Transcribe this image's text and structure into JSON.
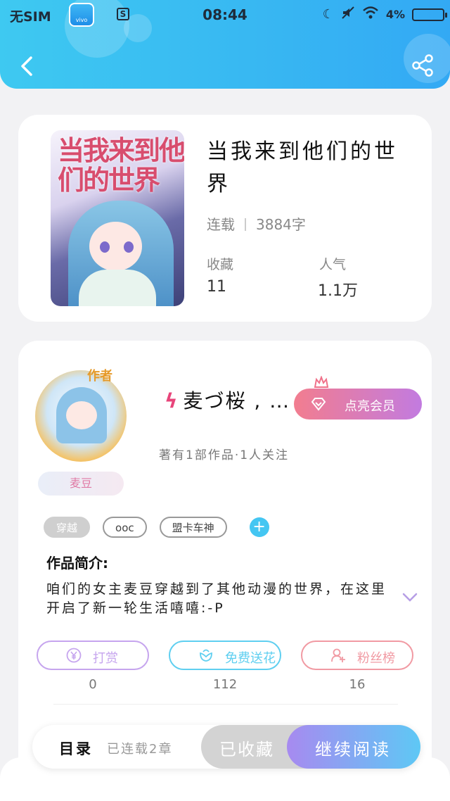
{
  "status_bar": {
    "carrier": "无SIM",
    "vivo_label": "vivo",
    "s_label": "S",
    "time": "08:44",
    "battery": "4%"
  },
  "book": {
    "cover_title": "当我来到他们的世界",
    "title": "当我来到他们的世界",
    "status": "连载",
    "word_count": "3884字",
    "stats": [
      {
        "label": "收藏",
        "value": "11"
      },
      {
        "label": "人气",
        "value": "1.1万"
      }
    ]
  },
  "author": {
    "role_badge": "作者",
    "name": "麦づ桜 , …",
    "meta": "著有1部作品·1人关注",
    "nickname_pill": "麦豆",
    "vip_button": "点亮会员"
  },
  "tags": [
    "穿越",
    "ooc",
    "盟卡车神"
  ],
  "intro": {
    "heading": "作品简介:",
    "text": "咱们的女主麦豆穿越到了其他动漫的世界，在这里开启了新一轮生活嘻嘻:-P"
  },
  "actions": [
    {
      "label": "打赏",
      "value": "0",
      "color": "#c6a5ee",
      "icon": "yen-icon"
    },
    {
      "label": "免费送花",
      "value": "112",
      "color": "#5fcff0",
      "icon": "flower-icon"
    },
    {
      "label": "粉丝榜",
      "value": "16",
      "color": "#f19aa3",
      "icon": "fans-icon"
    }
  ],
  "bottom_bar": {
    "toc": "目录",
    "toc_sub": "已连载2章",
    "favorited": "已收藏",
    "continue": "继续阅读"
  }
}
